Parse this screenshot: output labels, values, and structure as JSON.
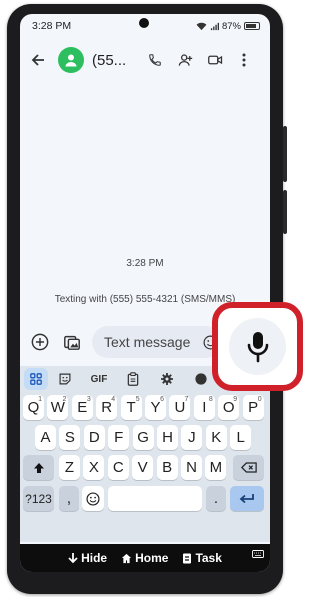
{
  "status_bar": {
    "time": "3:28 PM",
    "battery": "87%",
    "battery_level": 0.87
  },
  "app_bar": {
    "contact_title": "(55..."
  },
  "conversation": {
    "timestamp": "3:28 PM",
    "texting_info": "Texting with (555) 555-4321 (SMS/MMS)"
  },
  "compose": {
    "placeholder": "Text message"
  },
  "keyboard": {
    "toolbar": {
      "gif_label": "GIF"
    },
    "row1": [
      {
        "k": "Q",
        "s": "1"
      },
      {
        "k": "W",
        "s": "2"
      },
      {
        "k": "E",
        "s": "3"
      },
      {
        "k": "R",
        "s": "4"
      },
      {
        "k": "T",
        "s": "5"
      },
      {
        "k": "Y",
        "s": "6"
      },
      {
        "k": "U",
        "s": "7"
      },
      {
        "k": "I",
        "s": "8"
      },
      {
        "k": "O",
        "s": "9"
      },
      {
        "k": "P",
        "s": "0"
      }
    ],
    "row2": [
      "A",
      "S",
      "D",
      "F",
      "G",
      "H",
      "J",
      "K",
      "L"
    ],
    "row3": [
      "Z",
      "X",
      "C",
      "V",
      "B",
      "N",
      "M"
    ],
    "symbols_key": "?123",
    "comma_key": ",",
    "period_key": "."
  },
  "nav_bar": {
    "hide": "Hide",
    "home": "Home",
    "task": "Task"
  },
  "colors": {
    "accent_red": "#d0212b",
    "avatar_green": "#2dbe60",
    "enter_blue": "#a8c8ef"
  }
}
